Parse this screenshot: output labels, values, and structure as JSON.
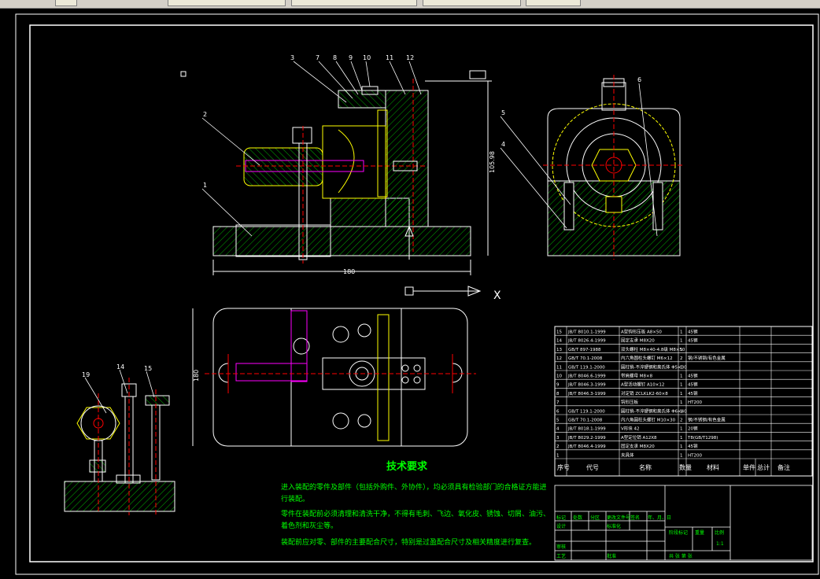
{
  "top_tabs": [
    "",
    "",
    "",
    "",
    ""
  ],
  "labels": {
    "top_view": [
      "3",
      "7",
      "8",
      "9",
      "10",
      "11",
      "12"
    ],
    "left_view": [
      "2",
      "1"
    ],
    "side_view": [
      "5",
      "4",
      "6"
    ],
    "small_view": [
      "19",
      "14",
      "15"
    ],
    "dim_height": "105.98",
    "dim_width": "180",
    "dim_plan": "180",
    "axis_x": "X"
  },
  "tech": {
    "title": "技术要求",
    "lines": [
      "进入装配的零件及部件（包括外购件、外协件），均必须具有检验部门的合格证方能进",
      "行装配。",
      "零件在装配前必须清理和清洗干净，不得有毛刺、飞边、氧化皮、锈蚀、切屑、油污、",
      "着色剂和灰尘等。",
      "装配前应对零、部件的主要配合尺寸，特别是过盈配合尺寸及相关精度进行复查。"
    ]
  },
  "bom": {
    "rows": [
      [
        "15",
        "JB/T 8010.1-1999",
        "A型钩形压板 A8×50",
        "1",
        "45钢",
        "",
        ""
      ],
      [
        "14",
        "JB/T 8026.4-1999",
        "固定支承 M8X20",
        "1",
        "45钢",
        "",
        ""
      ],
      [
        "13",
        "GB/T 897-1988",
        "双头螺柱 M8×40-4.8级 M8×50",
        "1",
        "",
        "",
        ""
      ],
      [
        "12",
        "GB/T 70.1-2008",
        "内六角圆柱头螺钉 M6×12",
        "2",
        "钢/不锈钢/有色金属",
        "",
        ""
      ],
      [
        "11",
        "GB/T 119.1-2000",
        "圆柱销-不淬硬钢和奥氏体 Φ5×30",
        "1",
        "",
        "",
        ""
      ],
      [
        "10",
        "JB/T 8046.6-1999",
        "带肩螺母 M8×8",
        "1",
        "45钢",
        "",
        ""
      ],
      [
        "9",
        "JB/T 8046.3-1999",
        "A型活动螺钉 A10×12",
        "1",
        "45钢",
        "",
        ""
      ],
      [
        "8",
        "JB/T 8046.3-1999",
        "对定销 ZCLKLK2-60×8",
        "1",
        "45钢",
        "",
        ""
      ],
      [
        "7",
        "",
        "钩形压板",
        "1",
        "HT200",
        "",
        ""
      ],
      [
        "6",
        "GB/T 119.1-2000",
        "圆柱销-不淬硬钢和奥氏体 Φ6×40",
        "1",
        "",
        "",
        ""
      ],
      [
        "5",
        "GB/T 70.1-2008",
        "内六角圆柱头螺钉 M10×30",
        "2",
        "钢/不锈钢/有色金属",
        "",
        ""
      ],
      [
        "4",
        "JB/T 8018.1-1999",
        "V形块 42",
        "1",
        "20钢",
        "",
        ""
      ],
      [
        "3",
        "JB/T 8029.2-1999",
        "A型定位销 A12X8",
        "1",
        "T8(GB/T1298)",
        "",
        ""
      ],
      [
        "2",
        "JB/T 8046.4-1999",
        "固定支承 M8X20",
        "1",
        "45钢",
        "",
        ""
      ],
      [
        "1",
        "",
        "夹具体",
        "1",
        "HT200",
        "",
        ""
      ]
    ],
    "header": [
      "序号",
      "代号",
      "名称",
      "数量",
      "材料",
      "单件",
      "总计",
      "备注"
    ],
    "title_block": {
      "mark": "标记",
      "count": "处数",
      "zone": "分区",
      "doc": "更改文件号",
      "sign": "签名",
      "date": "年、月、日",
      "design": "设计",
      "std": "标准化",
      "stage": "阶段标记",
      "weight": "重量",
      "scale": "比例",
      "scale_val": "1:1",
      "review": "审核",
      "process": "工艺",
      "approve": "批准",
      "sheets": "共  张  第  张"
    }
  },
  "colors": {
    "background": "#000000",
    "white": "#ffffff",
    "red": "#ff0000",
    "yellow": "#ffff00",
    "green": "#00ff00",
    "cyan": "#00ffff",
    "magenta": "#ff00ff",
    "hatch": "#00c000"
  }
}
